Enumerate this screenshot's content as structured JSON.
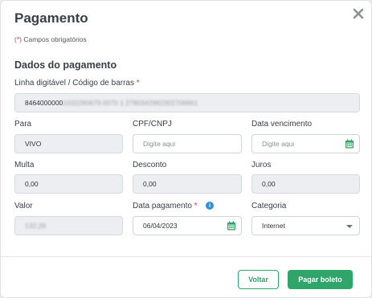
{
  "modal": {
    "title": "Pagamento",
    "required_marker": "(*)",
    "required_note": " Campos obrigatórios",
    "section_title": "Dados do pagamento"
  },
  "fields": {
    "barcode": {
      "label": "Linha digitável / Código de barras",
      "required": "*",
      "value_prefix": "8464000000",
      "value_hidden": "1032280679 0070 1 2780342982302709861"
    },
    "para": {
      "label": "Para",
      "value": "VIVO"
    },
    "cpf": {
      "label": "CPF/CNPJ",
      "placeholder": "Digite aqui"
    },
    "vencimento": {
      "label": "Data vencimento",
      "placeholder": "Digite aqui"
    },
    "multa": {
      "label": "Multa",
      "value": "0,00"
    },
    "desconto": {
      "label": "Desconto",
      "value": "0,00"
    },
    "juros": {
      "label": "Juros",
      "value": "0,00"
    },
    "valor": {
      "label": "Valor",
      "value": "132,28"
    },
    "data_pagamento": {
      "label": "Data pagamento",
      "required": "*",
      "value": "06/04/2023",
      "info_icon": "i"
    },
    "categoria": {
      "label": "Categoria",
      "value": "Internet"
    }
  },
  "buttons": {
    "back": "Voltar",
    "pay": "Pagar boleto"
  },
  "colors": {
    "accent": "#2fa56a",
    "required": "#e03a3a",
    "info": "#2f8fd8"
  },
  "icons": [
    "close-icon",
    "calendar-icon",
    "info-icon",
    "chevron-down-icon"
  ]
}
